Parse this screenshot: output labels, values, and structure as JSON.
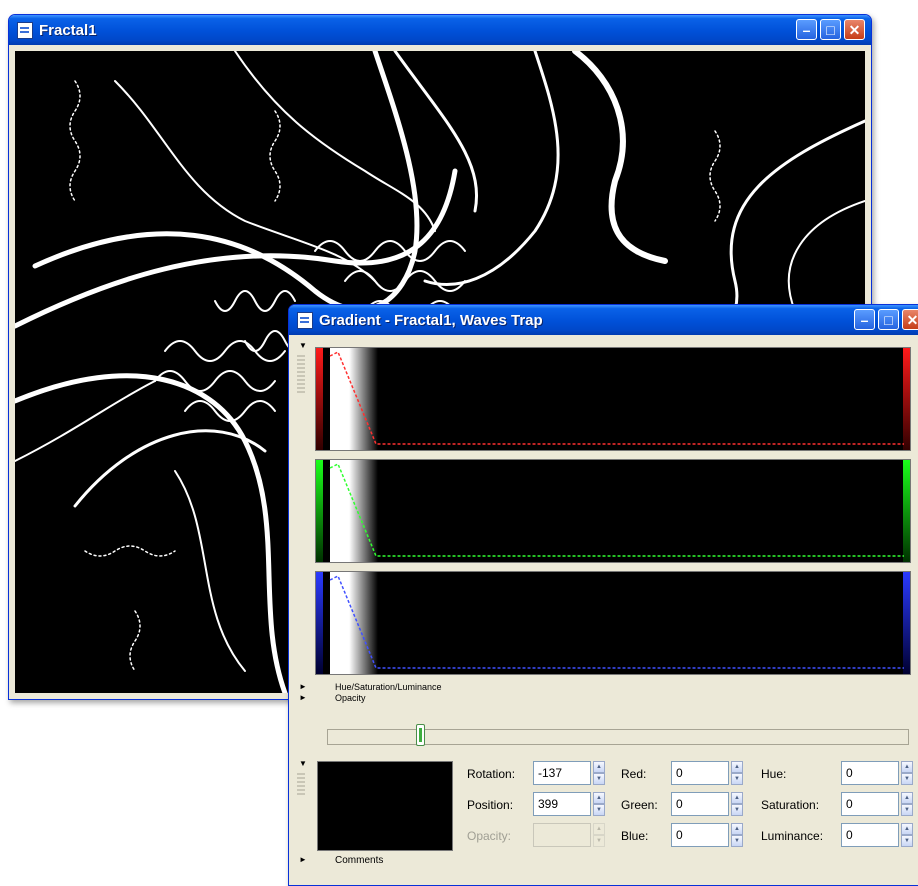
{
  "fractal_window": {
    "title": "Fractal1",
    "icon": "document-icon",
    "controls": [
      "minimize-icon",
      "maximize-icon",
      "close-icon"
    ]
  },
  "gradient_window": {
    "title": "Gradient - Fractal1, Waves Trap",
    "icon": "document-icon",
    "channels": [
      {
        "name": "red",
        "color": "#e02020"
      },
      {
        "name": "green",
        "color": "#20c020"
      },
      {
        "name": "blue",
        "color": "#2030e0"
      }
    ],
    "sections": {
      "hsl": "Hue/Saturation/Luminance",
      "opacity": "Opacity",
      "comments": "Comments"
    },
    "slider_position": 0.16,
    "fields": {
      "rotation": {
        "label": "Rotation:",
        "value": "-137"
      },
      "position": {
        "label": "Position:",
        "value": "399"
      },
      "opacity": {
        "label": "Opacity:",
        "value": ""
      },
      "red": {
        "label": "Red:",
        "value": "0"
      },
      "green": {
        "label": "Green:",
        "value": "0"
      },
      "blue": {
        "label": "Blue:",
        "value": "0"
      },
      "hue": {
        "label": "Hue:",
        "value": "0"
      },
      "saturation": {
        "label": "Saturation:",
        "value": "0"
      },
      "luminance": {
        "label": "Luminance:",
        "value": "0"
      }
    }
  }
}
